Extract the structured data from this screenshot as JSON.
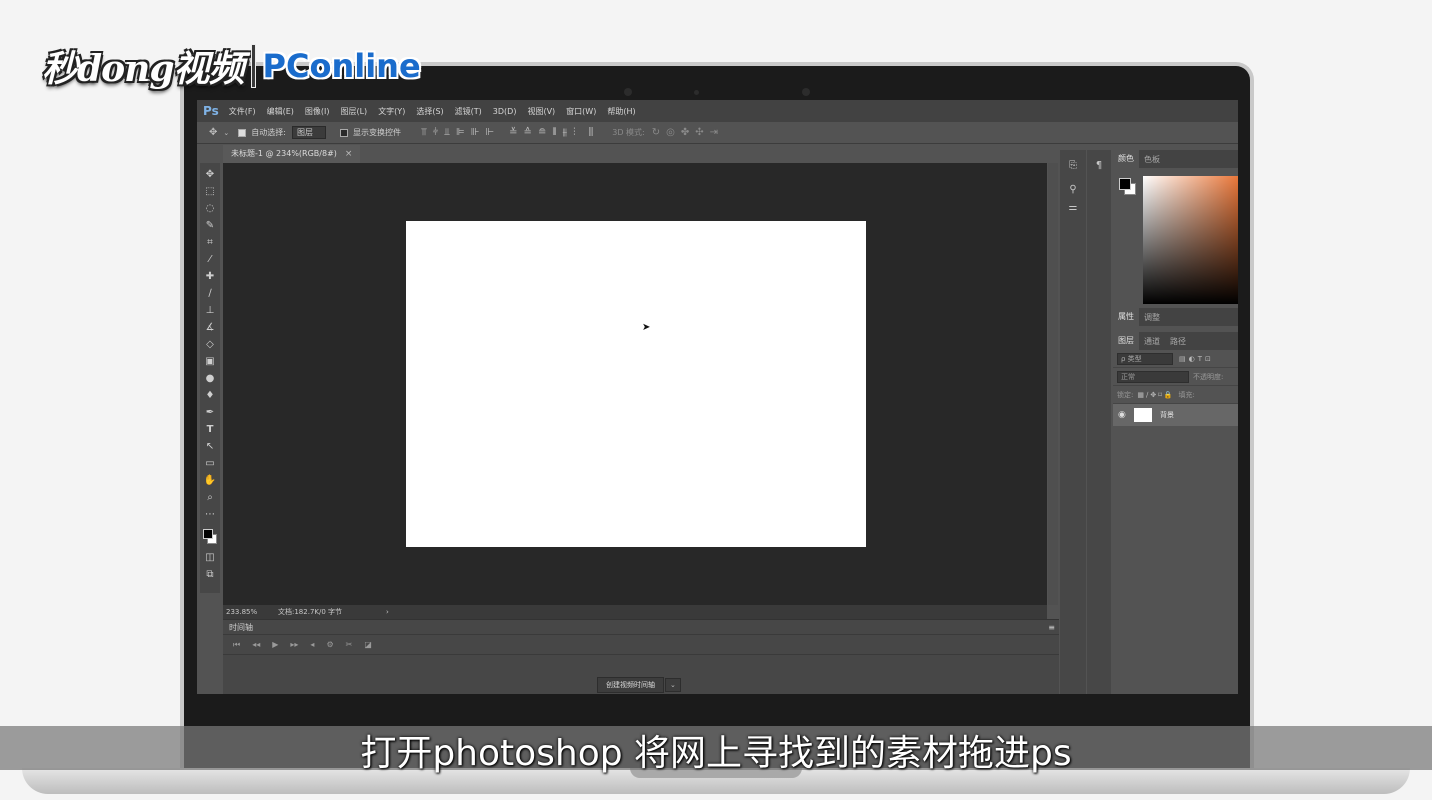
{
  "watermark": {
    "brand_left": "秒dong视频",
    "brand_right": "PConline"
  },
  "menubar": {
    "logo": "Ps",
    "items": [
      "文件(F)",
      "编辑(E)",
      "图像(I)",
      "图层(L)",
      "文字(Y)",
      "选择(S)",
      "滤镜(T)",
      "3D(D)",
      "视图(V)",
      "窗口(W)",
      "帮助(H)"
    ]
  },
  "options": {
    "move_icon": "move-icon",
    "auto_select_label": "自动选择:",
    "auto_select_value": "图层",
    "show_transform_label": "显示变换控件",
    "mode_3d_label": "3D 模式:"
  },
  "document": {
    "tab_title": "未标题-1 @ 234%(RGB/8#)",
    "close": "×"
  },
  "status": {
    "zoom": "233.85%",
    "doc_info": "文档:182.7K/0 字节",
    "arrow": "›"
  },
  "timeline": {
    "title": "时间轴",
    "create_button": "创建视频时间轴",
    "dropdown": "⌄",
    "menu": "≡"
  },
  "panels": {
    "color_tabs": [
      "颜色",
      "色板"
    ],
    "props_tabs": [
      "属性",
      "调整"
    ],
    "layer_tabs": [
      "图层",
      "通道",
      "路径"
    ],
    "kind_placeholder": "ρ 类型",
    "blend_mode": "正常",
    "opacity_label": "不透明度:",
    "lock_label": "锁定:",
    "fill_label": "填充:",
    "layer_name": "背景"
  },
  "subtitle": "打开photoshop 将网上寻找到的素材拖进ps"
}
